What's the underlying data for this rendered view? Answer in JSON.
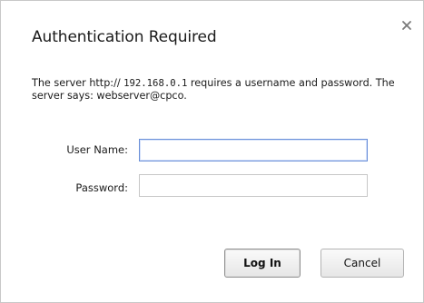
{
  "dialog": {
    "title": "Authentication Required",
    "close_symbol": "×",
    "close_icon": "close-icon",
    "message_part1": "The server http:// ",
    "message_host": "192.168.0.1",
    "message_part2": " requires a username and password. The server says: webserver@cpco."
  },
  "form": {
    "username_label": "User Name:",
    "username_value": "",
    "password_label": "Password:",
    "password_value": ""
  },
  "buttons": {
    "login_label": "Log In",
    "cancel_label": "Cancel"
  },
  "colors": {
    "focus_border": "#6a8fd8",
    "dialog_border": "#c8c8c8"
  }
}
